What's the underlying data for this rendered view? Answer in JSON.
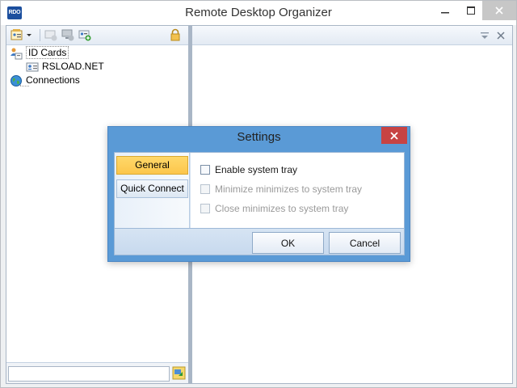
{
  "window": {
    "title": "Remote Desktop Organizer",
    "app_icon_text": "RDO",
    "controls": [
      "minimize-icon",
      "maximize-icon",
      "close-icon"
    ]
  },
  "toolbar": {
    "icons": [
      "new-card-dropdown-icon",
      "add-group-icon",
      "add-connection-icon",
      "add-card-icon",
      "lock-icon"
    ]
  },
  "tree": {
    "items": [
      {
        "label": "ID Cards",
        "icon": "id-cards-icon",
        "selected": true
      },
      {
        "label": "RSLOAD.NET",
        "icon": "id-card-icon"
      },
      {
        "label": "Connections",
        "icon": "globe-icon"
      }
    ]
  },
  "quick_connect": {
    "value": "",
    "icon": "connect-go-icon"
  },
  "right_header": {
    "icons": [
      "pin-dropdown-icon",
      "close-icon"
    ]
  },
  "dialog": {
    "title": "Settings",
    "nav": [
      {
        "label": "General",
        "active": true
      },
      {
        "label": "Quick Connect",
        "active": false
      }
    ],
    "options": [
      {
        "label": "Enable system tray",
        "checked": false,
        "enabled": true
      },
      {
        "label": "Minimize minimizes to system tray",
        "checked": false,
        "enabled": false
      },
      {
        "label": "Close minimizes to system tray",
        "checked": false,
        "enabled": false
      }
    ],
    "ok_label": "OK",
    "cancel_label": "Cancel"
  },
  "colors": {
    "dialog_frame": "#5a9ad6",
    "nav_active": "#fcc64b",
    "dialog_close": "#c74343",
    "panel_border": "#a9b6c6"
  }
}
